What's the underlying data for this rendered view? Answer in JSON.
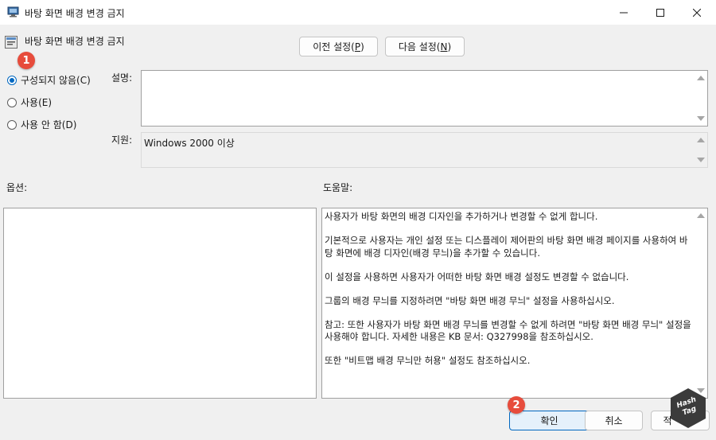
{
  "window": {
    "title": "바탕 화면 배경 변경 금지",
    "icon": "group-policy-editor-icon"
  },
  "header": {
    "policy_title": "바탕 화면 배경 변경 금지",
    "prev_button": "이전 설정(P)",
    "next_button": "다음 설정(N)"
  },
  "radios": [
    {
      "label": "구성되지 않음(C)",
      "checked": true
    },
    {
      "label": "사용(E)",
      "checked": false
    },
    {
      "label": "사용 안 함(D)",
      "checked": false
    }
  ],
  "fields": {
    "comment_label": "설명:",
    "comment_value": "",
    "supported_label": "지원:",
    "supported_value": "Windows 2000 이상"
  },
  "sections": {
    "options_label": "옵션:",
    "help_label": "도움말:"
  },
  "help_paragraphs": [
    "사용자가 바탕 화면의 배경 디자인을 추가하거나 변경할 수 없게 합니다.",
    "기본적으로 사용자는 개인 설정 또는 디스플레이 제어판의 바탕 화면 배경 페이지를 사용하여 바탕 화면에 배경 디자인(배경 무늬)을 추가할 수 있습니다.",
    "이 설정을 사용하면 사용자가 어떠한 바탕 화면 배경 설정도 변경할 수 없습니다.",
    "그룹의 배경 무늬를 지정하려면 \"바탕 화면 배경 무늬\" 설정을 사용하십시오.",
    "참고: 또한 사용자가 바탕 화면 배경 무늬를 변경할 수 없게 하려면 \"바탕 화면 배경 무늬\" 설정을 사용해야 합니다. 자세한 내용은 KB 문서: Q327998을 참조하십시오.",
    "또한 \"비트맵 배경 무늬만 허용\" 설정도 참조하십시오."
  ],
  "footer": {
    "ok_button": "확인",
    "cancel_button": "취소",
    "apply_button_partial": "적"
  },
  "annotations": {
    "badge_1": "1",
    "badge_2": "2",
    "color": "#e74c3c"
  },
  "watermark": {
    "line1": "Hash",
    "line2": "Tag"
  },
  "colors": {
    "accent": "#0067c0",
    "window_bg": "#f0f0f0"
  }
}
